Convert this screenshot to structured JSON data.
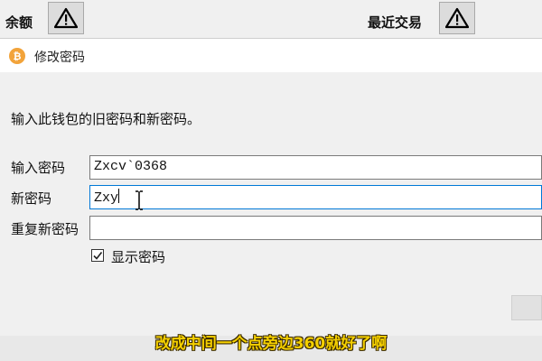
{
  "background_app": {
    "balance_label": "余额",
    "recent_tx_label": "最近交易"
  },
  "dialog": {
    "title": "修改密码",
    "title_icon": "bitcoin-icon",
    "instruction": "输入此钱包的旧密码和新密码。",
    "fields": {
      "old_password": {
        "label": "输入密码",
        "value": "Zxcv`0368"
      },
      "new_password": {
        "label": "新密码",
        "value": "Zxy"
      },
      "repeat_password": {
        "label": "重复新密码",
        "value": ""
      }
    },
    "show_password": {
      "label": "显示密码",
      "checked": true
    }
  },
  "caption": "改成中间一个点旁边360就好了啊",
  "colors": {
    "accent": "#0078d7",
    "caption": "#f5d000",
    "bitcoin": "#f2a33a"
  }
}
